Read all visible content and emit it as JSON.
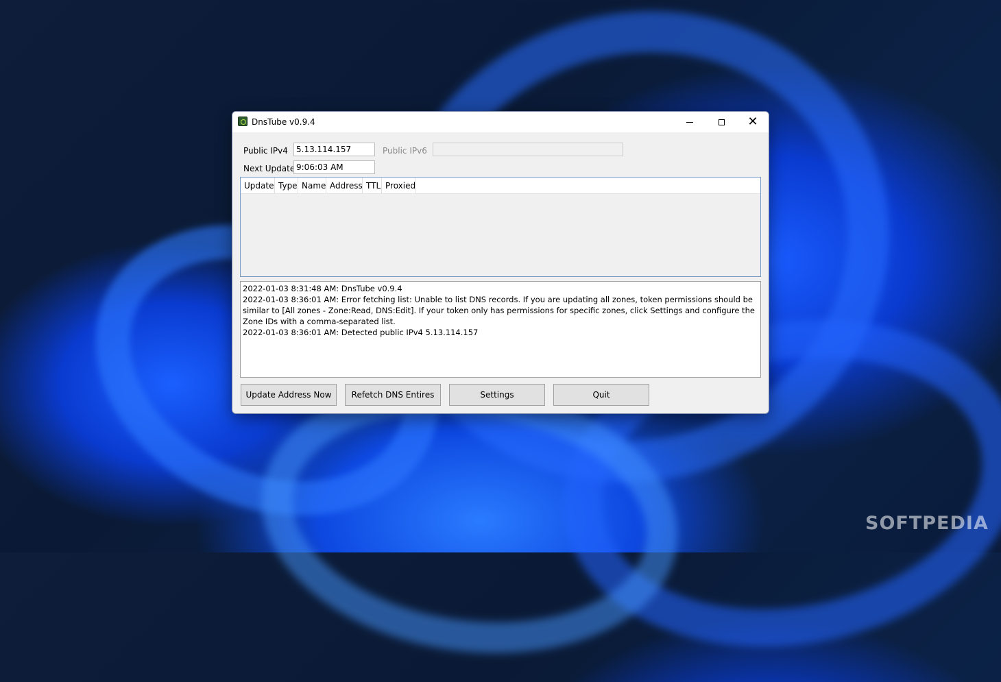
{
  "window": {
    "title": "DnsTube v0.9.4"
  },
  "fields": {
    "public_ipv4_label": "Public IPv4",
    "public_ipv4_value": "5.13.114.157",
    "public_ipv6_label": "Public IPv6",
    "public_ipv6_value": "",
    "next_update_label": "Next Update",
    "next_update_value": "9:06:03 AM"
  },
  "table": {
    "columns": [
      "Update",
      "Type",
      "Name",
      "Address",
      "TTL",
      "Proxied"
    ],
    "rows": []
  },
  "log": [
    "2022-01-03 8:31:48 AM: DnsTube v0.9.4",
    "2022-01-03 8:36:01 AM: Error fetching list: Unable to list DNS records. If you are updating all zones, token permissions should be similar to [All zones - Zone:Read, DNS:Edit]. If your token only has permissions for specific zones, click Settings and configure the Zone IDs with a comma-separated list.",
    "2022-01-03 8:36:01 AM: Detected public IPv4 5.13.114.157"
  ],
  "buttons": {
    "update_now": "Update Address Now",
    "refetch": "Refetch DNS Entires",
    "settings": "Settings",
    "quit": "Quit"
  },
  "desktop": {
    "watermark": "SOFTPEDIA"
  }
}
